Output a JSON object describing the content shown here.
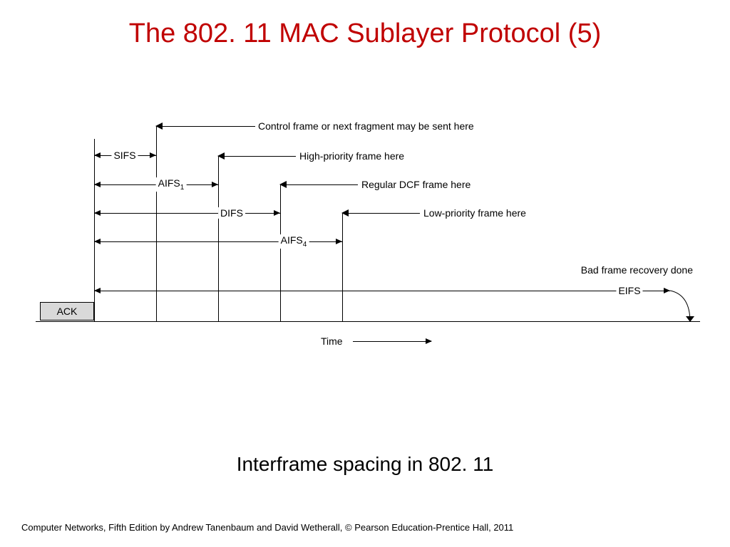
{
  "title": "The 802. 11 MAC Sublayer Protocol (5)",
  "caption": "Interframe spacing in 802. 11",
  "footer": "Computer Networks, Fifth Edition by Andrew Tanenbaum and David Wetherall, © Pearson Education-Prentice Hall, 2011",
  "diagram": {
    "ack": "ACK",
    "time_label": "Time",
    "spans": {
      "sifs": {
        "label": "SIFS",
        "sub": ""
      },
      "aifs1": {
        "label": "AIFS",
        "sub": "1"
      },
      "difs": {
        "label": "DIFS",
        "sub": ""
      },
      "aifs4": {
        "label": "AIFS",
        "sub": "4"
      },
      "eifs": {
        "label": "EIFS",
        "sub": ""
      }
    },
    "callouts": {
      "sifs": "Control frame or next fragment may be sent here",
      "aifs1": "High-priority frame here",
      "difs": "Regular DCF frame here",
      "aifs4": "Low-priority frame here",
      "eifs": "Bad frame recovery done"
    }
  },
  "chart_data": {
    "type": "diagram",
    "title": "Interframe spacing in 802.11",
    "xlabel": "Time",
    "origin_event": "ACK",
    "intervals_relative_width": {
      "SIFS": 1.0,
      "AIFS1": 2.0,
      "DIFS": 3.0,
      "AIFS4": 4.0,
      "EIFS": 9.3
    },
    "annotations": [
      {
        "at": "SIFS",
        "text": "Control frame or next fragment may be sent here"
      },
      {
        "at": "AIFS1",
        "text": "High-priority frame here"
      },
      {
        "at": "DIFS",
        "text": "Regular DCF frame here"
      },
      {
        "at": "AIFS4",
        "text": "Low-priority frame here"
      },
      {
        "at": "EIFS",
        "text": "Bad frame recovery done"
      }
    ]
  }
}
